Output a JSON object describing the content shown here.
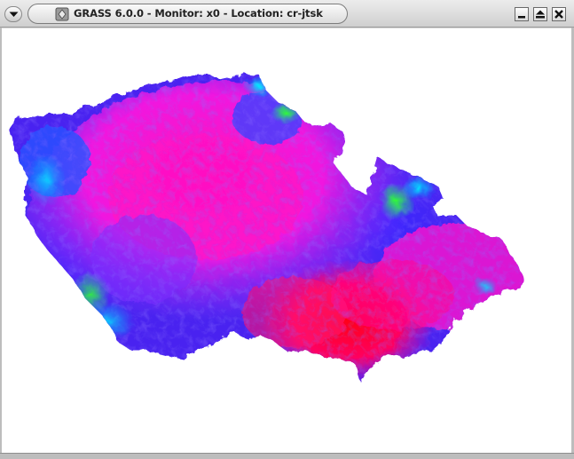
{
  "window": {
    "title": "GRASS 6.0.0 - Monitor: x0 - Location: cr-jtsk"
  },
  "titlebar_buttons": [
    "window-menu",
    "minimize",
    "maximize",
    "close"
  ],
  "map": {
    "region": "Czech Republic elevation raster",
    "colors": {
      "low": "#ff0020",
      "mid_low": "#ff00cc",
      "mid": "#6a2cff",
      "mid_high": "#3030ff",
      "high": "#00c8ff",
      "peak": "#20ff40",
      "background": "#ffffff"
    }
  }
}
